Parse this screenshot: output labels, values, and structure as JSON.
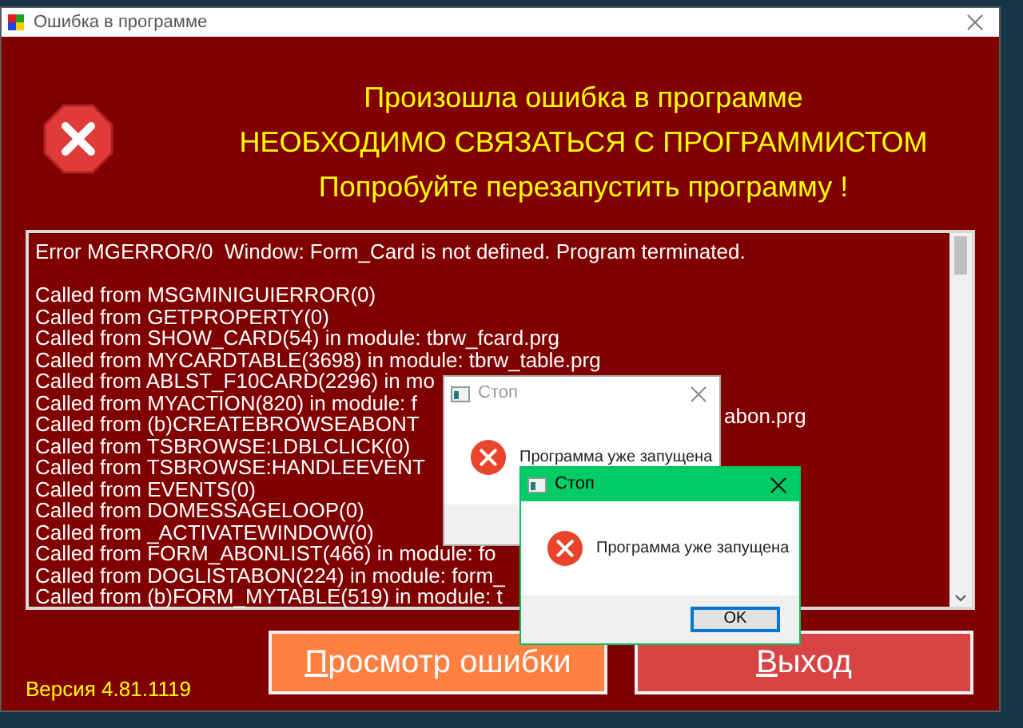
{
  "window": {
    "title": "Ошибка в программе"
  },
  "header": {
    "lines": [
      "Произошла ошибка в программе",
      "НЕОБХОДИМО СВЯЗАТЬСЯ С ПРОГРАММИСТОМ",
      "Попробуйте перезапустить программу !"
    ]
  },
  "trace": {
    "lines": [
      {
        "text": "Error MGERROR/0  Window: Form_Card is not defined. Program terminated."
      },
      {
        "text": "Called from MSGMINIGUIERROR(0)"
      },
      {
        "text": "Called from GETPROPERTY(0)"
      },
      {
        "text": "Called from SHOW_CARD(54) in module: tbrw_fcard.prg"
      },
      {
        "text": "Called from MYCARDTABLE(3698) in module: tbrw_table.prg"
      },
      {
        "text": "Called from ABLST_F10CARD(2296) in mo"
      },
      {
        "text": "Called from MYACTION(820) in module: f"
      },
      {
        "text": "Called from (b)CREATEBROWSEABONT",
        "tail": "abon.prg"
      },
      {
        "text": "Called from TSBROWSE:LDBLCLICK(0)"
      },
      {
        "text": "Called from TSBROWSE:HANDLEEVENT"
      },
      {
        "text": "Called from EVENTS(0)"
      },
      {
        "text": "Called from DOMESSAGELOOP(0)"
      },
      {
        "text": "Called from _ACTIVATEWINDOW(0)"
      },
      {
        "text": "Called from FORM_ABONLIST(466) in module: fo"
      },
      {
        "text": "Called from DOGLISTABON(224) in module: form_"
      },
      {
        "text": "Called from (b)FORM_MYTABLE(519) in module: t"
      }
    ]
  },
  "version": "Версия 4.81.1119",
  "buttons": [
    {
      "label": "Просмотр ошибки",
      "kind": "view"
    },
    {
      "label": "Выход",
      "kind": "exit"
    }
  ],
  "dialogs": [
    {
      "title": "Стоп",
      "message": "Программа уже запущена",
      "active": false
    },
    {
      "title": "Стоп",
      "message": "Программа уже запущена",
      "active": true,
      "button": "OK"
    }
  ]
}
